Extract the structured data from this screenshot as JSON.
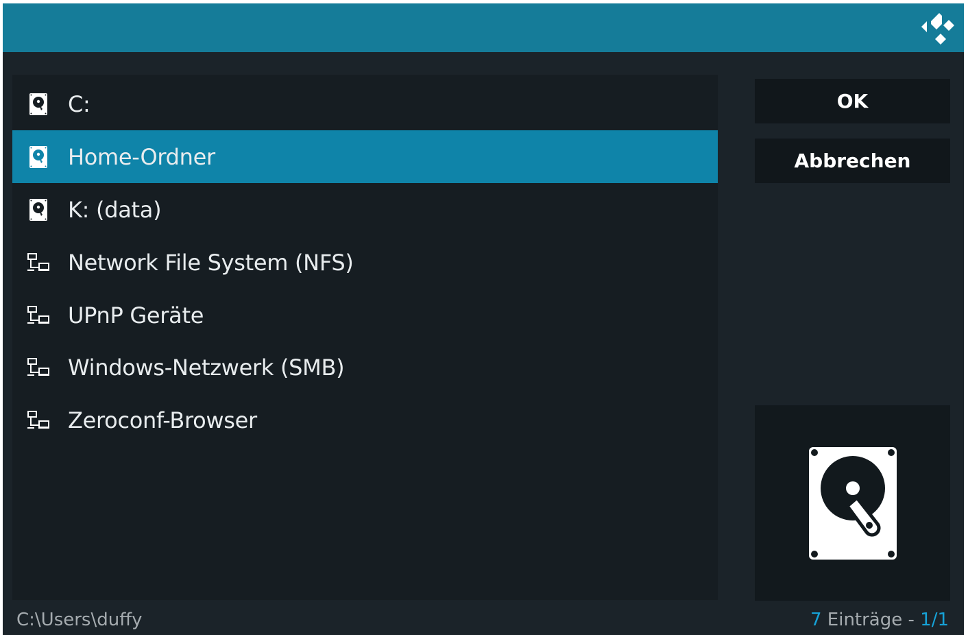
{
  "colors": {
    "header": "#157c99",
    "selected": "#0f84a9",
    "accent": "#16a2d7",
    "panel": "#161d22",
    "background": "#1b2329"
  },
  "header": {
    "logo_icon": "kodi-logo-icon"
  },
  "list": {
    "items": [
      {
        "label": "C:",
        "icon": "harddisk-icon",
        "selected": false
      },
      {
        "label": "Home-Ordner",
        "icon": "harddisk-icon",
        "selected": true
      },
      {
        "label": "K: (data)",
        "icon": "harddisk-icon",
        "selected": false
      },
      {
        "label": "Network File System (NFS)",
        "icon": "network-icon",
        "selected": false
      },
      {
        "label": "UPnP Geräte",
        "icon": "network-icon",
        "selected": false
      },
      {
        "label": "Windows-Netzwerk (SMB)",
        "icon": "network-icon",
        "selected": false
      },
      {
        "label": "Zeroconf-Browser",
        "icon": "network-icon",
        "selected": false
      }
    ]
  },
  "buttons": {
    "ok_label": "OK",
    "cancel_label": "Abbrechen"
  },
  "preview": {
    "icon": "harddisk-icon"
  },
  "footer": {
    "path": "C:\\Users\\duffy",
    "count_number": "7",
    "count_text": " Einträge - ",
    "page": "1/1"
  }
}
